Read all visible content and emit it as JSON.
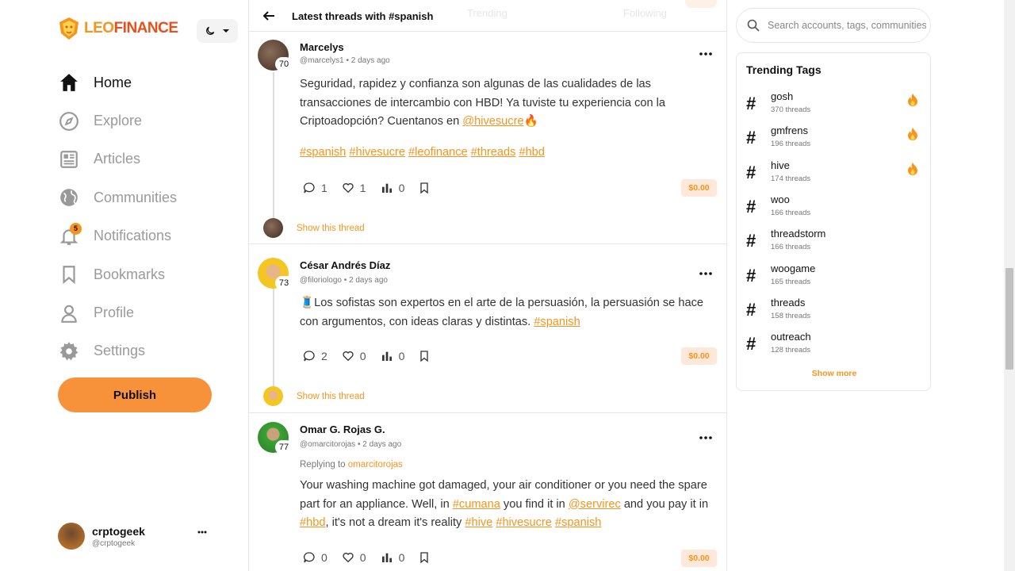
{
  "brand": {
    "name_part1": "LEO",
    "name_part2": "FINANCE"
  },
  "nav": [
    {
      "label": "Home",
      "icon": "home-icon",
      "active": true
    },
    {
      "label": "Explore",
      "icon": "compass-icon"
    },
    {
      "label": "Articles",
      "icon": "newspaper-icon"
    },
    {
      "label": "Communities",
      "icon": "globe-icon"
    },
    {
      "label": "Notifications",
      "icon": "bell-icon",
      "badge": "5"
    },
    {
      "label": "Bookmarks",
      "icon": "bookmark-icon"
    },
    {
      "label": "Profile",
      "icon": "user-icon"
    },
    {
      "label": "Settings",
      "icon": "gear-icon"
    }
  ],
  "publish_label": "Publish",
  "current_user": {
    "name": "crptogeek",
    "handle": "@crptogeek"
  },
  "header": {
    "title": "Latest threads with #spanish",
    "ghost_tab1": "Trending",
    "ghost_tab2": "Following"
  },
  "posts": [
    {
      "name": "Marcelys",
      "handle": "@marcelys1",
      "time": "2 days ago",
      "rep": "70",
      "body_pre": "Seguridad, rapidez y confianza son algunas de las cualidades de las transacciones de intercambio con HBD! Ya tuviste tu experiencia con la Criptoadopción? Cuentanos en ",
      "body_link": "@hivesucre",
      "body_post": "🔥",
      "tags": [
        "#spanish",
        "#hivesucre",
        "#leofinance",
        "#threads",
        "#hbd"
      ],
      "comments": "1",
      "likes": "1",
      "votes": "0",
      "payout": "$0.00",
      "show_thread": "Show this thread"
    },
    {
      "name": "César Andrés Díaz",
      "handle": "@filoriologo",
      "time": "2 days ago",
      "rep": "73",
      "body_pre": "🧵Los sofistas son expertos en el arte de la persuasión, la persuasión se hace con argumentos, con ideas claras y distintas. ",
      "body_link": "#spanish",
      "comments": "2",
      "likes": "0",
      "votes": "0",
      "payout": "$0.00",
      "show_thread": "Show this thread"
    },
    {
      "name": "Omar G. Rojas G.",
      "handle": "@omarcitorojas",
      "time": "2 days ago",
      "rep": "77",
      "replying_label": "Replying to",
      "replying_user": "omarcitorojas",
      "body_1": "Your washing machine got damaged, your air conditioner or you need the spare part for an appliance. Well, in ",
      "link_1": "#cumana",
      "body_2": " you find it in ",
      "link_2": "@servirec",
      "body_3": " and you pay it in ",
      "link_3": "#hbd",
      "body_4": ", it's not a dream it's reality ",
      "link_4": "#hive",
      "link_5": "#hivesucre",
      "link_6": "#spanish",
      "comments": "0",
      "likes": "0",
      "votes": "0",
      "payout": "$0.00"
    }
  ],
  "search": {
    "placeholder": "Search accounts, tags, communities"
  },
  "trending": {
    "title": "Trending Tags",
    "tags": [
      {
        "name": "gosh",
        "count": "370 threads",
        "hot": true
      },
      {
        "name": "gmfrens",
        "count": "196 threads",
        "hot": true
      },
      {
        "name": "hive",
        "count": "174 threads",
        "hot": true
      },
      {
        "name": "woo",
        "count": "166 threads",
        "hot": false
      },
      {
        "name": "threadstorm",
        "count": "166 threads",
        "hot": false
      },
      {
        "name": "woogame",
        "count": "165 threads",
        "hot": false
      },
      {
        "name": "threads",
        "count": "158 threads",
        "hot": false
      },
      {
        "name": "outreach",
        "count": "128 threads",
        "hot": false
      }
    ],
    "show_more": "Show more"
  },
  "colors": {
    "accent": "#f7941d",
    "publish_bg": "#f7923b",
    "payout_bg": "#fde8d9",
    "border": "#e6e6e6"
  }
}
